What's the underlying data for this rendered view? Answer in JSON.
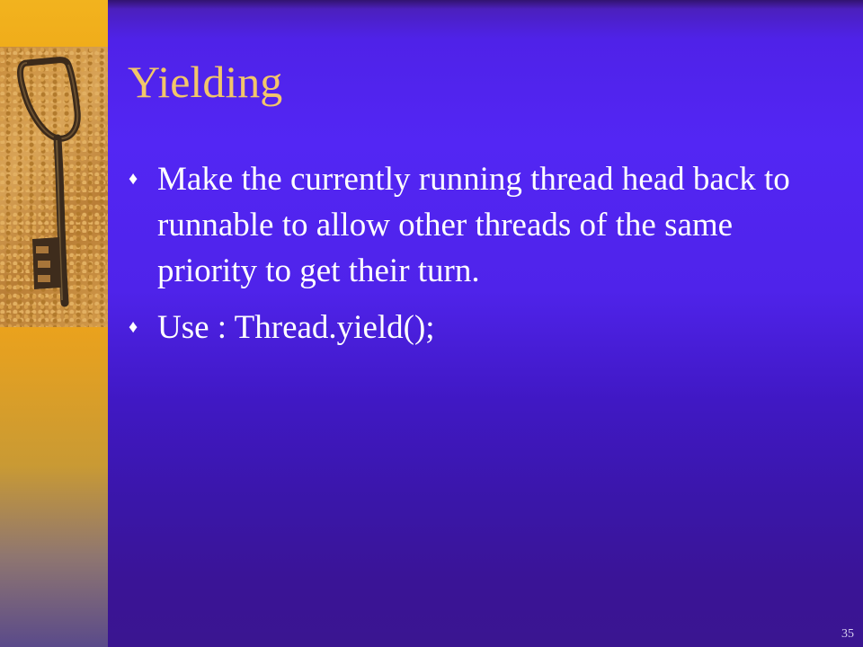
{
  "slide": {
    "title": "Yielding",
    "bullets": [
      {
        "marker": "♦",
        "text": "Make the currently running thread head back to runnable to allow other threads of the same priority to get their turn."
      },
      {
        "marker": "♦",
        "text": "Use : Thread.yield();"
      }
    ],
    "slide_number": "35"
  },
  "decor": {
    "image": "key-photo",
    "icon": "diamond-bullet-icon"
  },
  "colors": {
    "background": "#5326f4",
    "left_strip": "#eba21c",
    "title": "#f2c66a",
    "body_text": "#ffffff"
  }
}
